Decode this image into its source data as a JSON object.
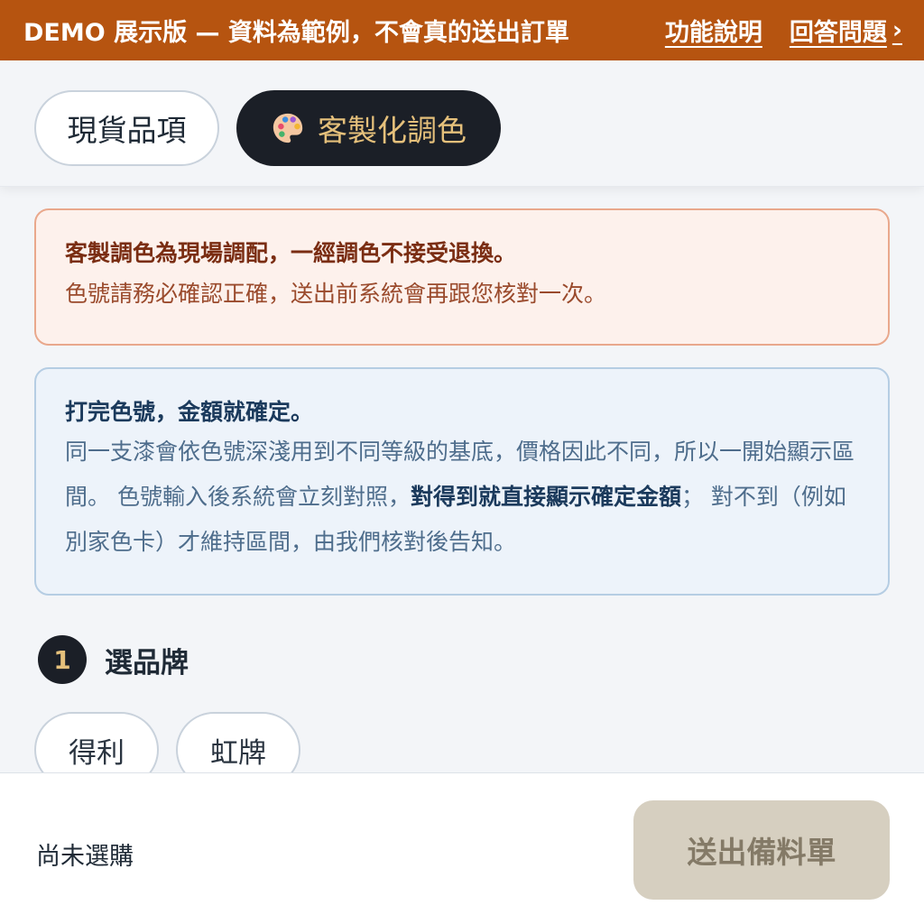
{
  "banner": {
    "demo_text": "DEMO 展示版 — 資料為範例，不會真的送出訂單",
    "link_features": "功能說明",
    "link_answer": "回答問題",
    "link_answer_chevron": "›",
    "background_color": "#b65410"
  },
  "tabs": [
    {
      "label": "現貨品項",
      "active": false
    },
    {
      "label": "客製化調色",
      "active": true,
      "icon": "palette-icon"
    }
  ],
  "warning_notice": {
    "title": "客製調色為現場調配，一經調色不接受退換。",
    "body": "色號請務必確認正確，送出前系統會再跟您核對一次。"
  },
  "info_notice": {
    "title": "打完色號，金額就確定。",
    "body_part1": "同一支漆會依色號深淺用到不同等級的基底，價格因此不同，所以一開始顯示區間。 色號輸入後系統會立刻對照，",
    "body_bold": "對得到就直接顯示確定金額",
    "body_part2": "； 對不到（例如別家色卡）才維持區間，由我們核對後告知。"
  },
  "step1": {
    "number": "1",
    "label": "選品牌",
    "brands": [
      "得利",
      "虹牌"
    ]
  },
  "bottom_bar": {
    "status": "尚未選購",
    "submit_label": "送出備料單"
  }
}
